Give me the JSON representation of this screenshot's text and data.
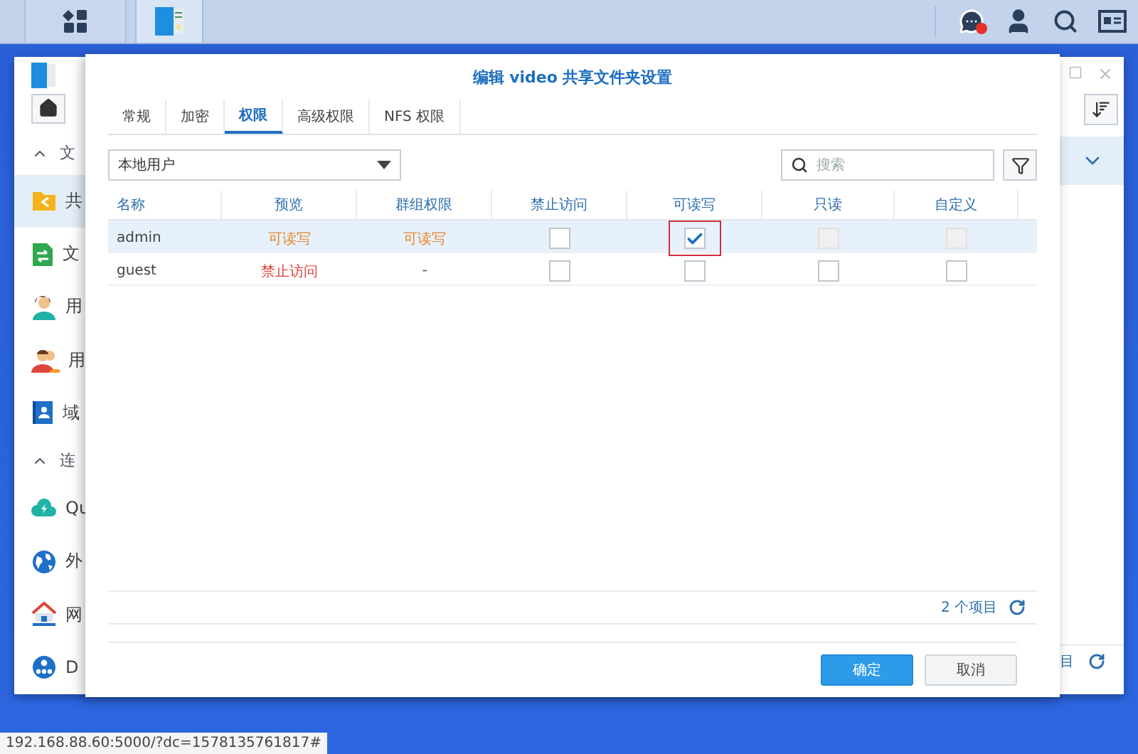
{
  "taskbar": {
    "buttons": [
      {
        "kind": "grid",
        "selected": false
      },
      {
        "kind": "app",
        "selected": true
      }
    ],
    "tray": [
      {
        "kind": "chat",
        "badge": true
      },
      {
        "kind": "user",
        "badge": false
      },
      {
        "kind": "search",
        "badge": false
      },
      {
        "kind": "card",
        "badge": false
      }
    ]
  },
  "background_window": {
    "sidebar": [
      {
        "kind": "header",
        "label": "文"
      },
      {
        "kind": "share",
        "label": "共",
        "selected": true
      },
      {
        "kind": "sync",
        "label": "文",
        "selected": false
      },
      {
        "kind": "user",
        "label": "用",
        "selected": false
      },
      {
        "kind": "group",
        "label": "用",
        "selected": false
      },
      {
        "kind": "domain",
        "label": "域",
        "selected": false
      },
      {
        "kind": "header",
        "label": "连"
      },
      {
        "kind": "cloud",
        "label": "Qu",
        "selected": false
      },
      {
        "kind": "globe",
        "label": "外",
        "selected": false
      },
      {
        "kind": "home",
        "label": "网",
        "selected": false
      },
      {
        "kind": "dhcp",
        "label": "D",
        "selected": false
      }
    ],
    "footer_text": "目"
  },
  "dialog": {
    "title": "编辑 video 共享文件夹设置",
    "tabs": [
      {
        "label": "常规",
        "selected": false
      },
      {
        "label": "加密",
        "selected": false
      },
      {
        "label": "权限",
        "selected": true
      },
      {
        "label": "高级权限",
        "selected": false
      },
      {
        "label": "NFS 权限",
        "selected": false
      }
    ],
    "user_type": "本地用户",
    "search": {
      "placeholder": "搜索"
    },
    "table": {
      "columns": [
        "名称",
        "预览",
        "群组权限",
        "禁止访问",
        "可读写",
        "只读",
        "自定义"
      ],
      "rows": [
        {
          "name": "admin",
          "selected": true,
          "preview": {
            "text": "可读写",
            "color": "#e8862a"
          },
          "group": {
            "text": "可读写",
            "color": "#e8862a"
          },
          "permissions": [
            {
              "checked": false,
              "disabled": false,
              "highlighted": false
            },
            {
              "checked": true,
              "disabled": false,
              "highlighted": true
            },
            {
              "checked": false,
              "disabled": true,
              "highlighted": false
            },
            {
              "checked": false,
              "disabled": true,
              "highlighted": false
            }
          ]
        },
        {
          "name": "guest",
          "selected": false,
          "preview": {
            "text": "禁止访问",
            "color": "#e0453a"
          },
          "group": {
            "text": "-",
            "color": "#555555"
          },
          "permissions": [
            {
              "checked": false,
              "disabled": false,
              "highlighted": false
            },
            {
              "checked": false,
              "disabled": false,
              "highlighted": false
            },
            {
              "checked": false,
              "disabled": false,
              "highlighted": false
            },
            {
              "checked": false,
              "disabled": false,
              "highlighted": false
            }
          ]
        }
      ]
    },
    "count": "2 个项目",
    "buttons": [
      {
        "label": "确定",
        "kind": "primary"
      },
      {
        "label": "取消",
        "kind": "secondary"
      }
    ]
  },
  "status_url": "192.168.88.60:5000/?dc=1578135761817#"
}
